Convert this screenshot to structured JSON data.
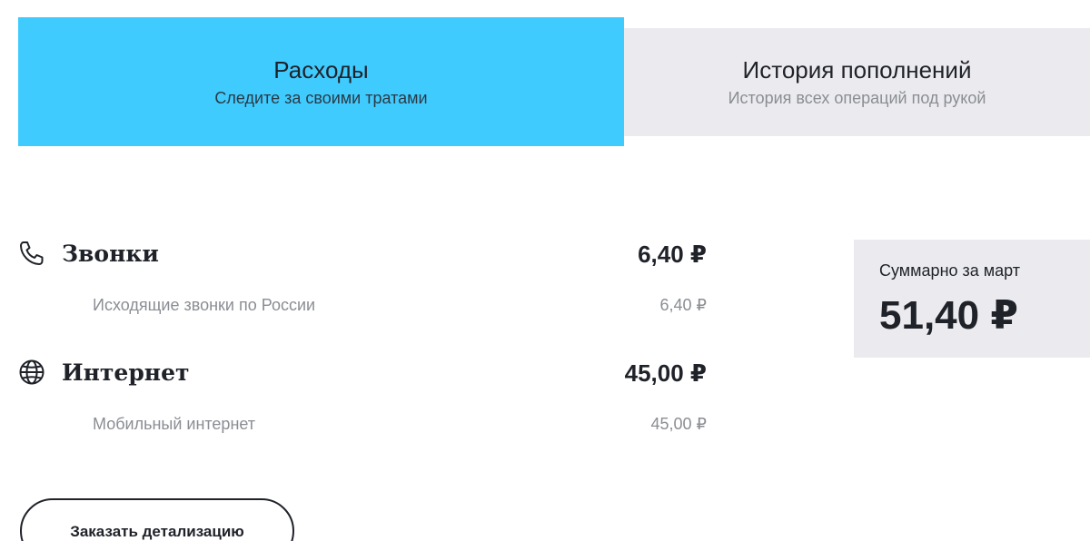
{
  "tabs": [
    {
      "title": "Расходы",
      "subtitle": "Следите за своими тратами",
      "active": true
    },
    {
      "title": "История пополнений",
      "subtitle": "История всех операций под рукой",
      "active": false
    }
  ],
  "sections": [
    {
      "icon": "phone-icon",
      "title": "Звонки",
      "amount": "6,40 ₽",
      "items": [
        {
          "label": "Исходящие звонки по России",
          "amount": "6,40 ₽"
        }
      ]
    },
    {
      "icon": "globe-icon",
      "title": "Интернет",
      "amount": "45,00 ₽",
      "items": [
        {
          "label": "Мобильный интернет",
          "amount": "45,00 ₽"
        }
      ]
    }
  ],
  "summary": {
    "label": "Суммарно за март",
    "amount": "51,40 ₽"
  },
  "detail_button": {
    "label": "Заказать детализацию"
  },
  "colors": {
    "active_tab": "#40cbff",
    "inactive_tab": "#ebebef",
    "text_dark": "#1f2229",
    "text_muted": "#8a8d93"
  }
}
